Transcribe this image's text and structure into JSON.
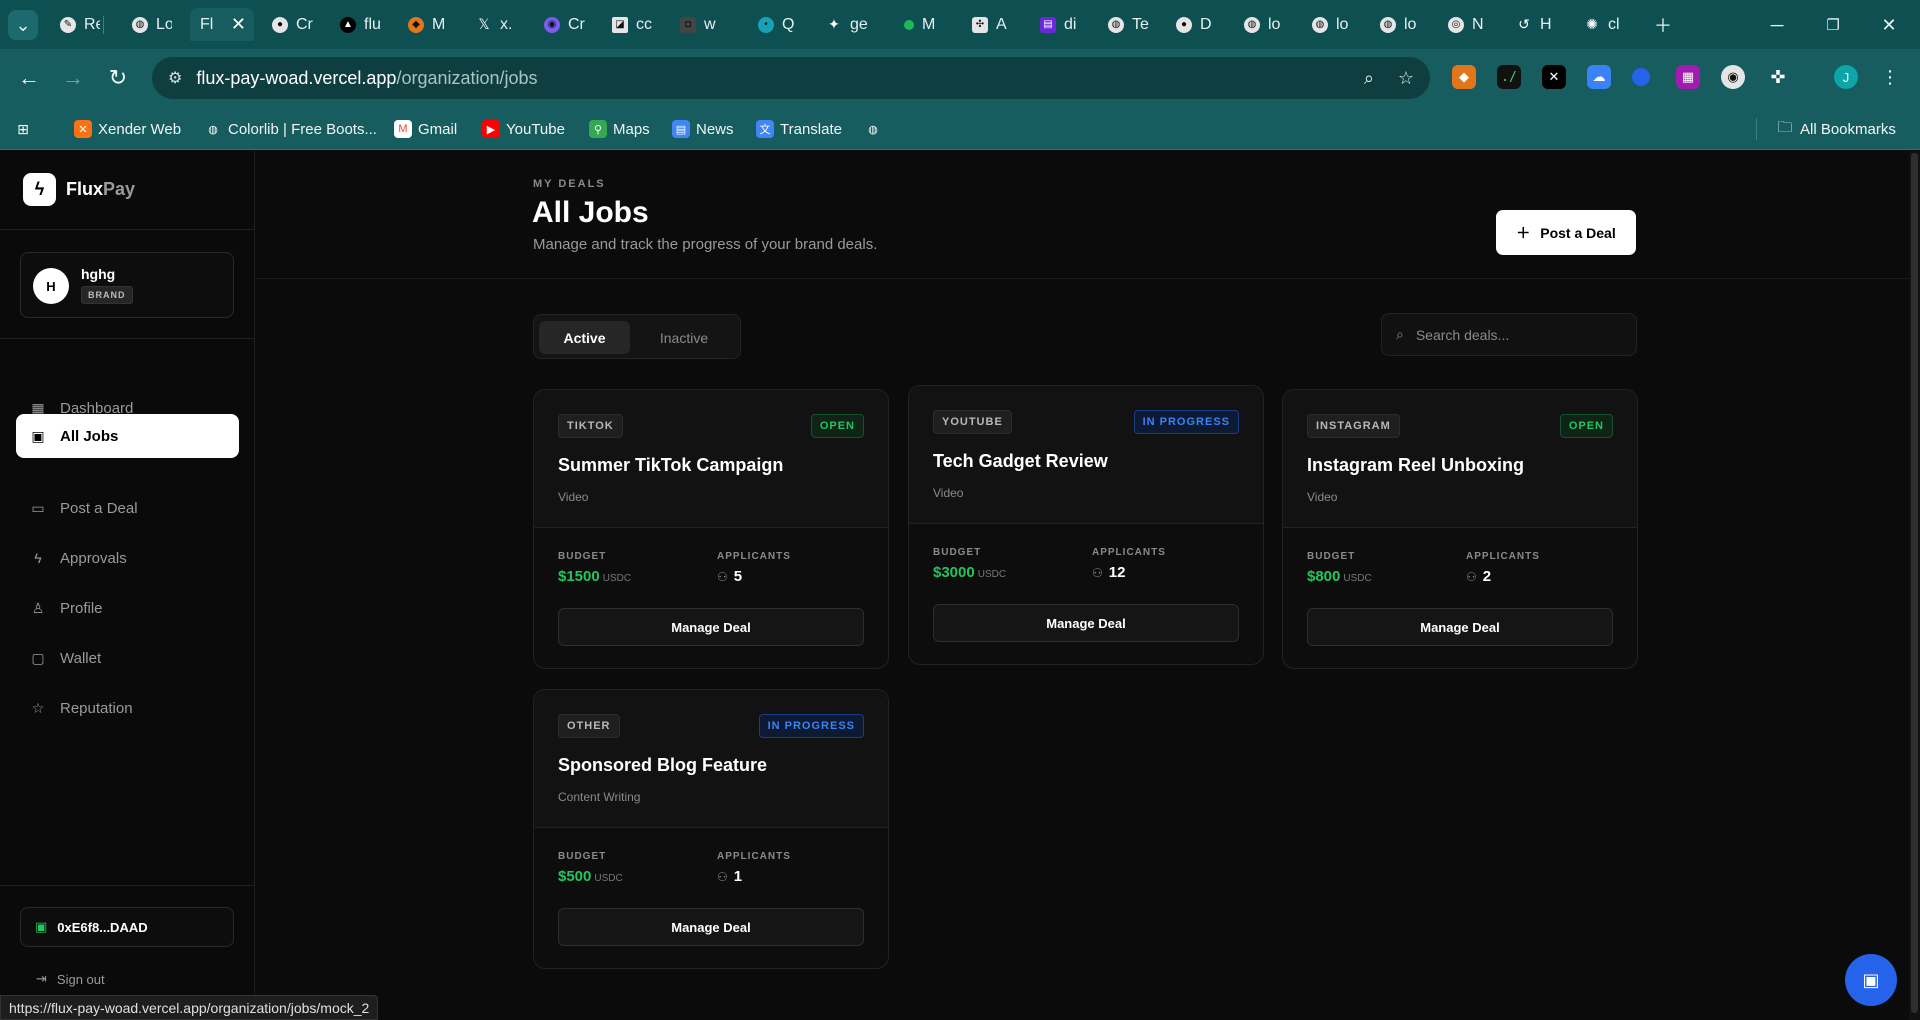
{
  "browser": {
    "tabs": [
      {
        "label": "Re",
        "icon": "pen-icon"
      },
      {
        "label": "Lo",
        "icon": "globe-icon"
      },
      {
        "label": "Fl",
        "icon": "flux-icon",
        "active": true
      },
      {
        "label": "Cr",
        "icon": "github-icon"
      },
      {
        "label": "flu",
        "icon": "triangle-icon"
      },
      {
        "label": "M",
        "icon": "metamask-icon"
      },
      {
        "label": "x.",
        "icon": "x-icon"
      },
      {
        "label": "Cr",
        "icon": "circle-icon"
      },
      {
        "label": "cc",
        "icon": "square-icon"
      },
      {
        "label": "w",
        "icon": "square-icon"
      },
      {
        "label": "Q",
        "icon": "tenk-icon"
      },
      {
        "label": "ge",
        "icon": "sparkle-icon"
      },
      {
        "label": "M",
        "icon": "dot-icon"
      },
      {
        "label": "A",
        "icon": "app-icon"
      },
      {
        "label": "di",
        "icon": "purple-icon"
      },
      {
        "label": "Te",
        "icon": "globe-icon"
      },
      {
        "label": "D",
        "icon": "github-icon"
      },
      {
        "label": "lo",
        "icon": "globe-icon"
      },
      {
        "label": "lo",
        "icon": "globe-icon"
      },
      {
        "label": "lo",
        "icon": "globe-icon"
      },
      {
        "label": "N",
        "icon": "chrome-icon"
      },
      {
        "label": "H",
        "icon": "history-icon"
      },
      {
        "label": "cl",
        "icon": "asterisk-icon"
      }
    ],
    "url_host": "flux-pay-woad.vercel.app",
    "url_path": "/organization/jobs",
    "bookmarks": [
      {
        "label": "Xender Web"
      },
      {
        "label": "Colorlib | Free Boots..."
      },
      {
        "label": "Gmail"
      },
      {
        "label": "YouTube"
      },
      {
        "label": "Maps"
      },
      {
        "label": "News"
      },
      {
        "label": "Translate"
      },
      {
        "label": ""
      }
    ],
    "all_bookmarks": "All Bookmarks",
    "profile_initial": "J",
    "status_url": "https://flux-pay-woad.vercel.app/organization/jobs/mock_2"
  },
  "app": {
    "brand_main": "Flux",
    "brand_accent": "Pay",
    "user": {
      "initial": "H",
      "name": "hghg",
      "role": "BRAND"
    },
    "nav": [
      {
        "label": "Dashboard",
        "icon": "grid-icon"
      },
      {
        "label": "All Jobs",
        "icon": "briefcase-icon",
        "active": true
      },
      {
        "label": "Post a Deal",
        "icon": "file-icon"
      },
      {
        "label": "Approvals",
        "icon": "bolt-icon"
      },
      {
        "label": "Profile",
        "icon": "user-icon"
      },
      {
        "label": "Wallet",
        "icon": "wallet-icon"
      },
      {
        "label": "Reputation",
        "icon": "star-icon"
      }
    ],
    "wallet_address": "0xE6f8...DAAD",
    "signout": "Sign out"
  },
  "main": {
    "eyebrow": "MY DEALS",
    "title": "All Jobs",
    "subtitle": "Manage and track the progress of your brand deals.",
    "post_button": "Post a Deal",
    "tabs": [
      {
        "label": "Active"
      },
      {
        "label": "Inactive"
      }
    ],
    "search_placeholder": "Search deals...",
    "budget_label": "BUDGET",
    "applicants_label": "APPLICANTS",
    "currency": "USDC",
    "manage_label": "Manage Deal",
    "cards": [
      {
        "platform": "TIKTOK",
        "status": "OPEN",
        "title": "Summer TikTok Campaign",
        "type": "Video",
        "budget": "$1500",
        "applicants": "5"
      },
      {
        "platform": "YOUTUBE",
        "status": "IN PROGRESS",
        "title": "Tech Gadget Review",
        "type": "Video",
        "budget": "$3000",
        "applicants": "12"
      },
      {
        "platform": "INSTAGRAM",
        "status": "OPEN",
        "title": "Instagram Reel Unboxing",
        "type": "Video",
        "budget": "$800",
        "applicants": "2"
      },
      {
        "platform": "OTHER",
        "status": "IN PROGRESS",
        "title": "Sponsored Blog Feature",
        "type": "Content Writing",
        "budget": "$500",
        "applicants": "1"
      }
    ]
  },
  "colors": {
    "accent_green": "#22c55e",
    "accent_blue": "#3b82f6",
    "chrome_teal": "#175c5e"
  }
}
